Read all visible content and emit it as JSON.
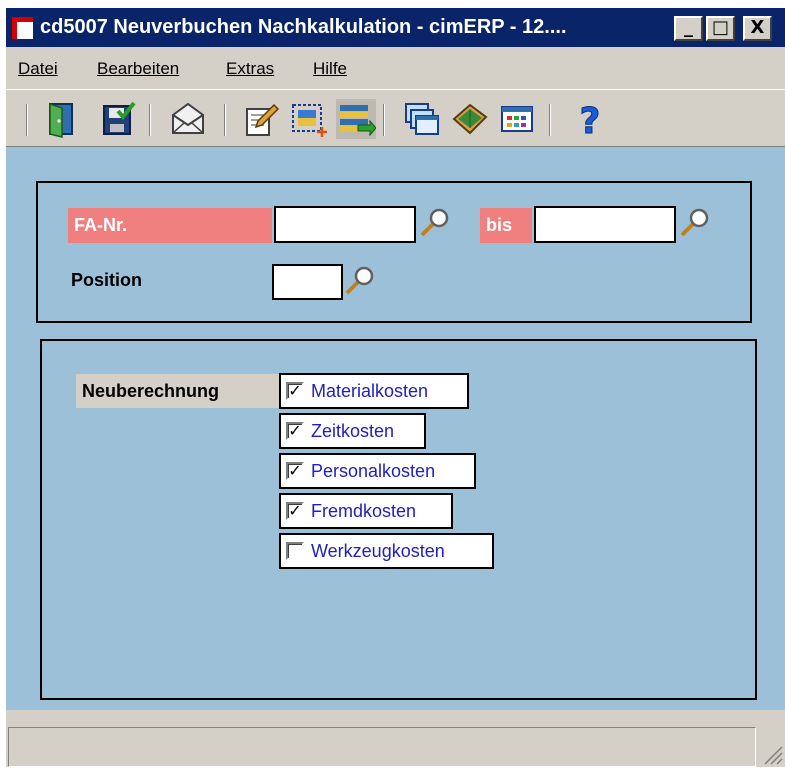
{
  "window": {
    "title": "cd5007 Neuverbuchen Nachkalkulation - cimERP - 12....",
    "controls": {
      "minimize": "_",
      "maximize": "□",
      "close": "X"
    }
  },
  "menu": {
    "items": [
      {
        "label": "Datei"
      },
      {
        "label": "Bearbeiten"
      },
      {
        "label": "Extras"
      },
      {
        "label": "Hilfe"
      }
    ]
  },
  "toolbar": {
    "buttons": [
      {
        "icon": "exit-door-icon"
      },
      {
        "icon": "save-icon"
      },
      {
        "icon": "mail-icon"
      },
      {
        "icon": "edit-document-icon"
      },
      {
        "icon": "new-record-icon"
      },
      {
        "icon": "post-list-icon"
      },
      {
        "icon": "windows-icon"
      },
      {
        "icon": "book-icon"
      },
      {
        "icon": "calendar-grid-icon"
      },
      {
        "icon": "help-icon",
        "label": "?"
      }
    ]
  },
  "form": {
    "fa_nr": {
      "label": "FA-Nr.",
      "value": ""
    },
    "bis": {
      "label": "bis",
      "value": ""
    },
    "position": {
      "label": "Position",
      "value": ""
    }
  },
  "options": {
    "label": "Neuberechnung",
    "checkboxes": [
      {
        "label": "Materialkosten",
        "checked": true,
        "mark": "✓"
      },
      {
        "label": "Zeitkosten",
        "checked": true,
        "mark": "✓"
      },
      {
        "label": "Personalkosten",
        "checked": true,
        "mark": "✓"
      },
      {
        "label": "Fremdkosten",
        "checked": true,
        "mark": "✓"
      },
      {
        "label": "Werkzeugkosten",
        "checked": false,
        "mark": ""
      }
    ]
  },
  "colors": {
    "title_bar": "#0a246a",
    "client_bg": "#9dc0d9",
    "required_label": "#f08080",
    "checkbox_text": "#2020c0"
  }
}
